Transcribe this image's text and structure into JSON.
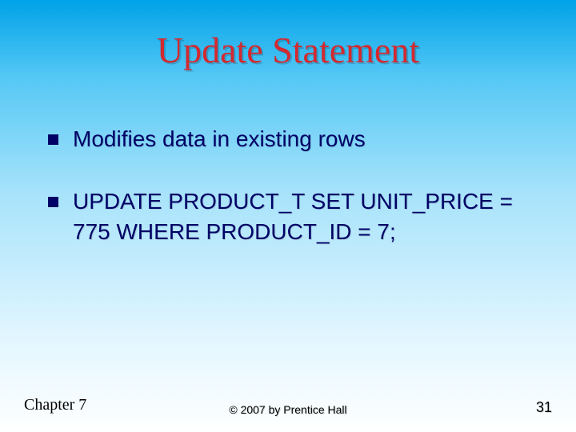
{
  "title": "Update Statement",
  "bullets": [
    "Modifies data in existing rows",
    "UPDATE PRODUCT_T SET UNIT_PRICE = 775 WHERE PRODUCT_ID = 7;"
  ],
  "footer": {
    "left": "Chapter 7",
    "center": "© 2007 by Prentice Hall",
    "right": "31"
  }
}
